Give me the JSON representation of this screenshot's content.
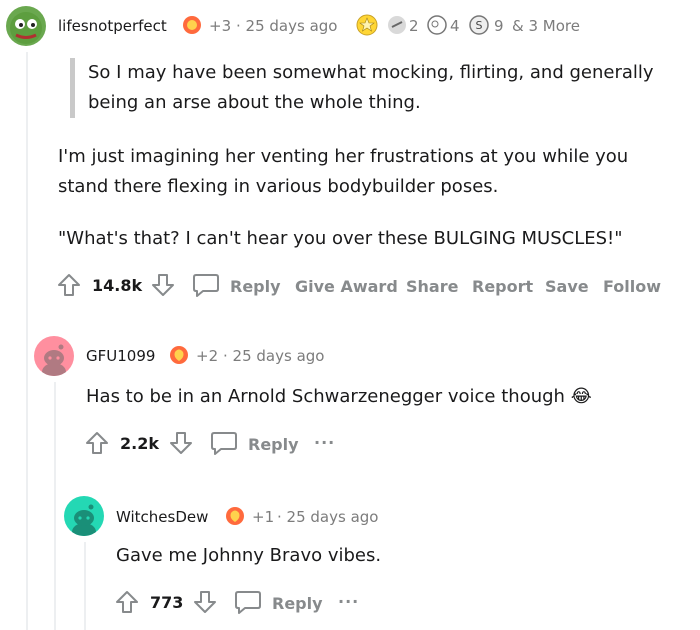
{
  "colors": {
    "text": "#1a1a1b",
    "muted": "#7c7c7c",
    "action": "#878a8c",
    "quote_bar": "#c9c9c9",
    "thread_line": "#edeff1"
  },
  "comments": [
    {
      "author": "lifesnotperfect",
      "award_delta": "+3",
      "time": "· 25 days ago",
      "awards": [
        {
          "icon": "gold-award-icon"
        },
        {
          "icon": "award-icon",
          "count": "2"
        },
        {
          "icon": "award-icon",
          "count": "4"
        },
        {
          "icon": "award-icon",
          "count": "9"
        }
      ],
      "more_awards": "& 3 More",
      "quote": [
        "So I may have been somewhat mocking, flirting, and generally",
        "being an arse about the whole thing."
      ],
      "paragraphs": [
        [
          "I'm just imagining her venting her frustrations at you while you",
          "stand there flexing in various bodybuilder poses."
        ],
        [
          "\"What's that? I can't hear you over these BULGING MUSCLES!\""
        ]
      ],
      "score": "14.8k",
      "actions": [
        "Reply",
        "Give Award",
        "Share",
        "Report",
        "Save",
        "Follow"
      ]
    },
    {
      "author": "GFU1099",
      "award_delta": "+2",
      "time": "· 25 days ago",
      "text": "Has to be in an Arnold Schwarzenegger voice though",
      "emoji": "😂",
      "score": "2.2k",
      "reply": "Reply",
      "more": "···"
    },
    {
      "author": "WitchesDew",
      "award_delta": "+1",
      "time": "· 25 days ago",
      "text": "Gave me Johnny Bravo vibes.",
      "score": "773",
      "reply": "Reply",
      "more": "···"
    }
  ]
}
